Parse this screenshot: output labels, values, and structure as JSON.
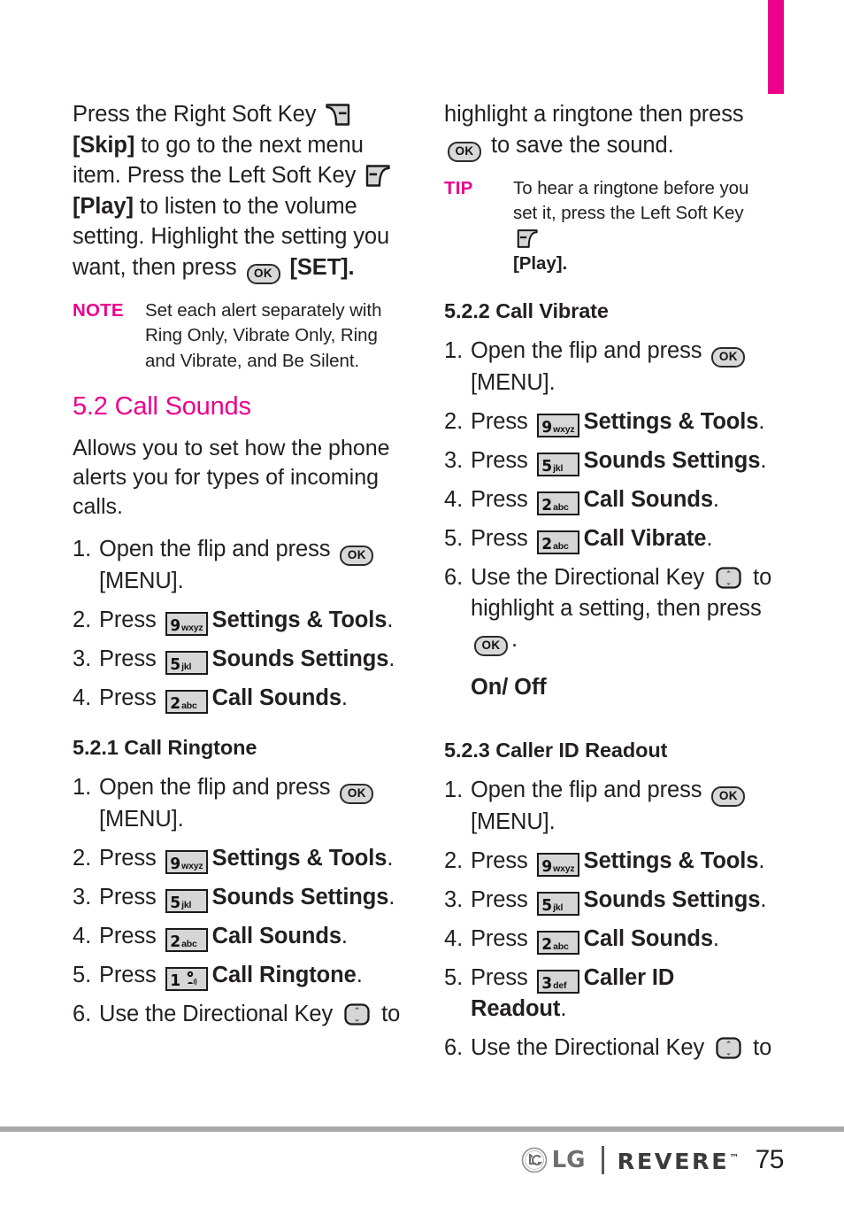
{
  "page": {
    "number": "75",
    "brand": {
      "logo_icon": "lg-circle-logo-icon",
      "lg_text": "LG",
      "model_text": "REVERE",
      "trademark": "™"
    }
  },
  "tab_marker": {
    "color": "#ec008c"
  },
  "left_column": {
    "intro_paragraph": {
      "seg1": "Press the Right Soft Key ",
      "icon1": "right-soft-key-icon",
      "seg2": "[Skip]",
      "seg3": " to go to the next menu item. Press the Left Soft Key ",
      "icon2": "left-soft-key-icon",
      "seg4": "[Play]",
      "seg5": " to listen to the volume setting. Highlight the setting you want, then press ",
      "icon3": "ok-key-icon",
      "seg6": " [SET]."
    },
    "note": {
      "tag": "NOTE",
      "text": "Set each alert separately with Ring Only, Vibrate Only, Ring and Vibrate, and Be Silent."
    },
    "section": {
      "heading": "5.2 Call Sounds",
      "description": "Allows you to set how the phone alerts you for types of incoming calls.",
      "steps": [
        {
          "num": "1.",
          "text_before": "Open the flip and press ",
          "key": "ok",
          "text_after": "",
          "label": "",
          "label_after": "",
          "second_line": "[MENU]."
        },
        {
          "num": "2.",
          "text_before": "Press ",
          "key": "9",
          "key_letters": "wxyz",
          "label": "Settings & Tools",
          "label_after": "."
        },
        {
          "num": "3.",
          "text_before": "Press ",
          "key": "5",
          "key_letters": "jkl",
          "label": "Sounds Settings",
          "label_after": "."
        },
        {
          "num": "4.",
          "text_before": "Press ",
          "key": "2",
          "key_letters": "abc",
          "label": "Call Sounds",
          "label_after": "."
        }
      ]
    },
    "subsection": {
      "heading": "5.2.1 Call Ringtone",
      "steps": [
        {
          "num": "1.",
          "text_before": "Open the flip and press ",
          "key": "ok",
          "second_line": "[MENU]."
        },
        {
          "num": "2.",
          "text_before": "Press ",
          "key": "9",
          "key_letters": "wxyz",
          "label": "Settings & Tools",
          "label_after": "."
        },
        {
          "num": "3.",
          "text_before": "Press ",
          "key": "5",
          "key_letters": "jkl",
          "label": "Sounds Settings",
          "label_after": "."
        },
        {
          "num": "4.",
          "text_before": "Press ",
          "key": "2",
          "key_letters": "abc",
          "label": "Call Sounds",
          "label_after": "."
        },
        {
          "num": "5.",
          "text_before": "Press ",
          "key": "1",
          "key_letters": "voicemail",
          "label": "Call Ringtone",
          "label_after": "."
        },
        {
          "num": "6.",
          "text_before": "Use the Directional Key ",
          "key": "dir",
          "text_after": " to"
        }
      ]
    }
  },
  "right_column": {
    "continued_step": {
      "line1": "highlight a ringtone then press",
      "icon": "ok-key-icon",
      "line2_after": " to save the sound."
    },
    "tip": {
      "tag": "TIP",
      "text_before": "To hear a ringtone before you set it, press the Left Soft Key ",
      "icon": "left-soft-key-icon",
      "text_after": "[Play]."
    },
    "subsection_vibrate": {
      "heading": "5.2.2 Call Vibrate",
      "steps": [
        {
          "num": "1.",
          "text_before": "Open the flip and press ",
          "key": "ok",
          "second_line": "[MENU]."
        },
        {
          "num": "2.",
          "text_before": "Press ",
          "key": "9",
          "key_letters": "wxyz",
          "label": "Settings & Tools",
          "label_after": "."
        },
        {
          "num": "3.",
          "text_before": "Press ",
          "key": "5",
          "key_letters": "jkl",
          "label": "Sounds Settings",
          "label_after": "."
        },
        {
          "num": "4.",
          "text_before": "Press ",
          "key": "2",
          "key_letters": "abc",
          "label": "Call Sounds",
          "label_after": "."
        },
        {
          "num": "5.",
          "text_before": "Press ",
          "key": "2",
          "key_letters": "abc",
          "label": "Call Vibrate",
          "label_after": "."
        },
        {
          "num": "6.",
          "text_before": "Use the Directional Key ",
          "key": "dir",
          "text_after": " to",
          "second_line": "highlight a setting, then press",
          "third_line_key": "ok",
          "third_line_after": "."
        }
      ],
      "option": "On/ Off"
    },
    "subsection_callerid": {
      "heading": "5.2.3 Caller ID Readout",
      "steps": [
        {
          "num": "1.",
          "text_before": "Open the flip and press ",
          "key": "ok",
          "second_line": "[MENU]."
        },
        {
          "num": "2.",
          "text_before": "Press ",
          "key": "9",
          "key_letters": "wxyz",
          "label": "Settings & Tools",
          "label_after": "."
        },
        {
          "num": "3.",
          "text_before": "Press ",
          "key": "5",
          "key_letters": "jkl",
          "label": "Sounds Settings",
          "label_after": "."
        },
        {
          "num": "4.",
          "text_before": "Press ",
          "key": "2",
          "key_letters": "abc",
          "label": "Call Sounds",
          "label_after": "."
        },
        {
          "num": "5.",
          "text_before": "Press ",
          "key": "3",
          "key_letters": "def",
          "label": "Caller ID Readout",
          "label_after": "."
        },
        {
          "num": "6.",
          "text_before": "Use the Directional Key ",
          "key": "dir",
          "text_after": " to"
        }
      ]
    }
  },
  "colors": {
    "accent_pink": "#ec008c",
    "text": "#231f20",
    "rule_gray": "#a6a8ab",
    "key_fill": "#d6d6d6"
  }
}
